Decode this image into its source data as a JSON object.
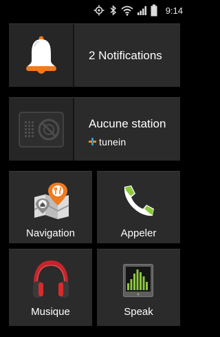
{
  "status_bar": {
    "time": "9:14",
    "icons": [
      "gps-icon",
      "bluetooth-icon",
      "wifi-icon",
      "signal-icon",
      "battery-icon"
    ]
  },
  "notifications_tile": {
    "label": "2 Notifications",
    "icon": "bell-icon"
  },
  "radio_tile": {
    "label": "Aucune station",
    "brand": "tunein",
    "icon": "radio-icon"
  },
  "navigation_tile": {
    "label": "Navigation",
    "icon": "map-icon"
  },
  "call_tile": {
    "label": "Appeler",
    "icon": "phone-icon"
  },
  "music_tile": {
    "label": "Musique",
    "icon": "headphones-icon"
  },
  "speak_tile": {
    "label": "Speak",
    "icon": "equalizer-icon"
  },
  "colors": {
    "background": "#000000",
    "tile": "#2b2b2b",
    "bell_orange": "#f07a1e",
    "phone_green": "#8cc63f",
    "headphones_red": "#d92b2b",
    "tunein_blue": "#1ea0dc",
    "tunein_orange": "#f28a1c"
  }
}
